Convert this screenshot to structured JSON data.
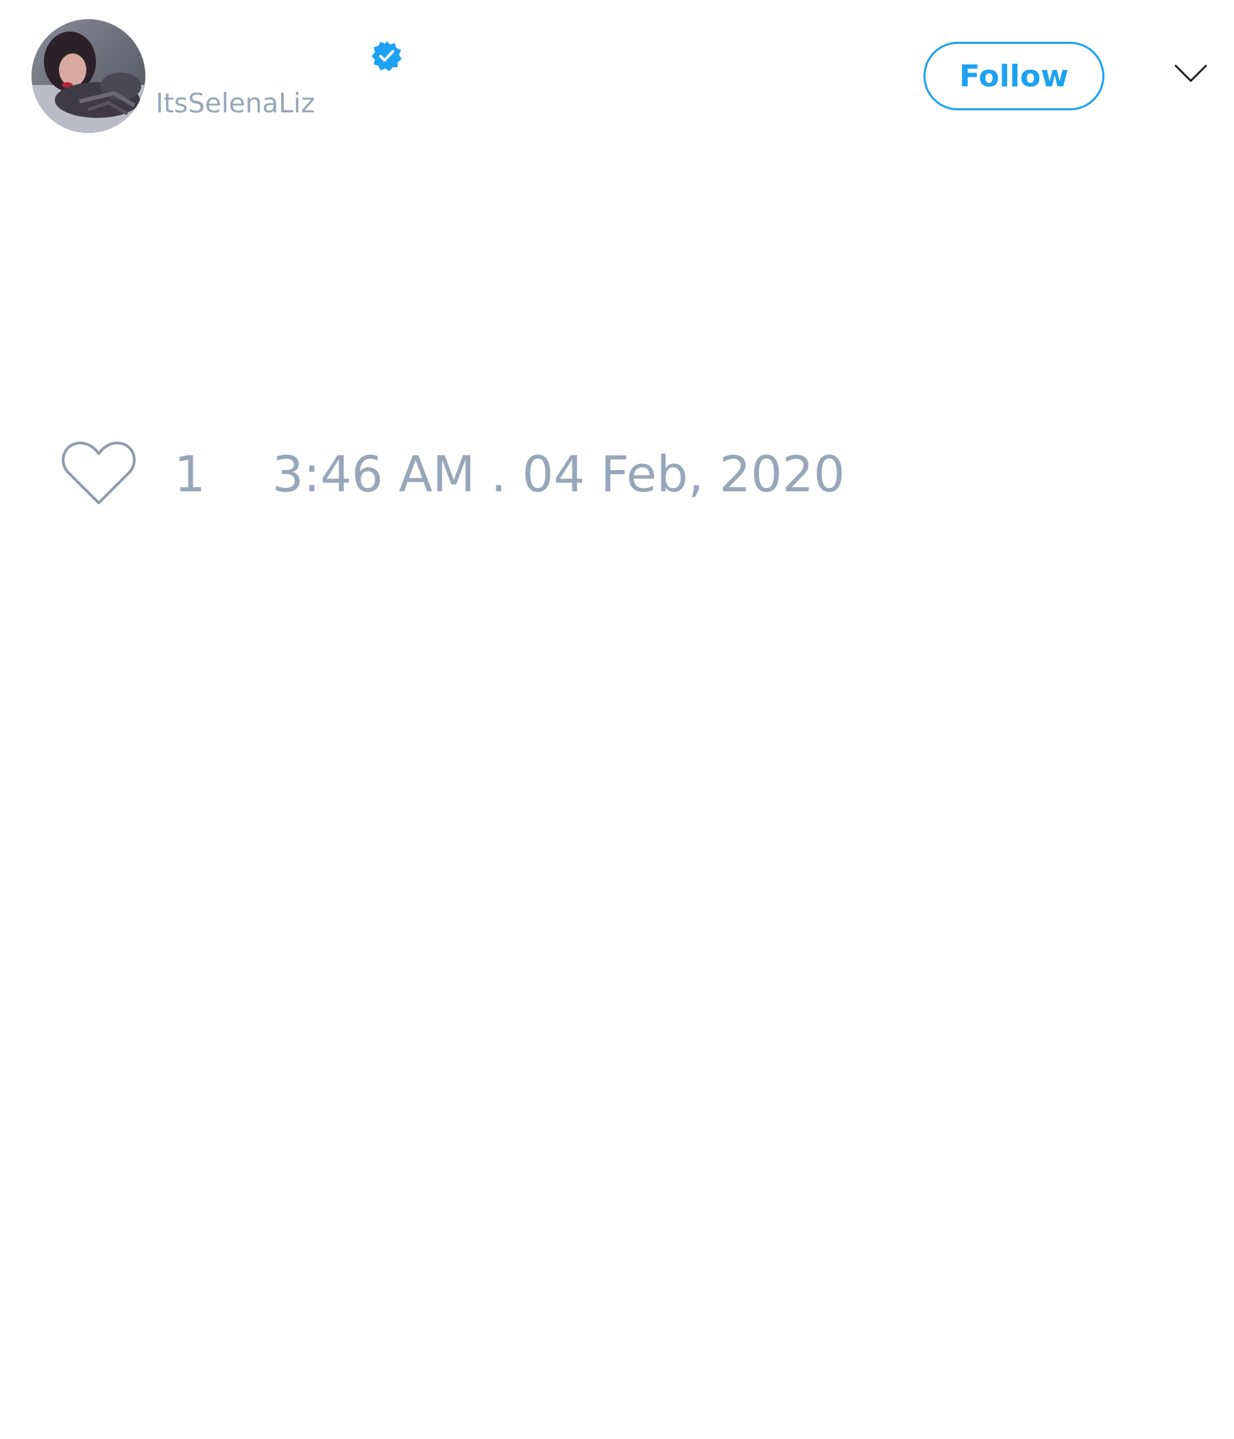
{
  "tweet": {
    "author": {
      "handle": "ItsSelenaLiz",
      "verified": true,
      "avatar_icon": "profile-photo"
    },
    "follow_label": "Follow",
    "menu_icon": "chevron-down-icon",
    "like_icon": "heart-outline-icon",
    "like_count": "1",
    "timestamp": "3:46 AM . 04 Feb, 2020"
  },
  "colors": {
    "accent": "#1da1f2",
    "muted_text": "#98a6ba",
    "background": "#ffffff",
    "icon_dark": "#222222"
  }
}
